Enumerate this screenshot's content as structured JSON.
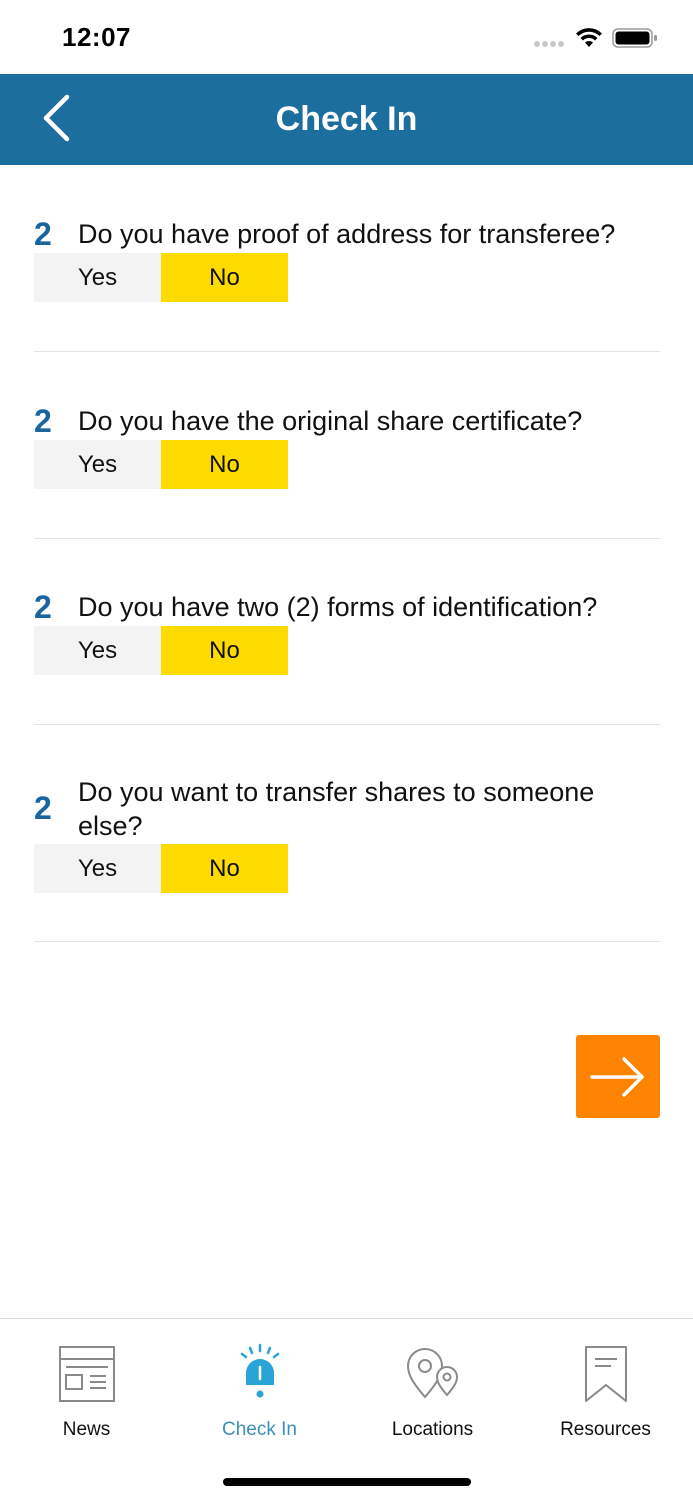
{
  "status_bar": {
    "time": "12:07"
  },
  "header": {
    "title": "Check In"
  },
  "questions": [
    {
      "number": "2",
      "text": "Do you have proof of address for transferee?",
      "yes_label": "Yes",
      "no_label": "No",
      "selected": "No"
    },
    {
      "number": "2",
      "text": "Do you have the original share certificate?",
      "yes_label": "Yes",
      "no_label": "No",
      "selected": "No"
    },
    {
      "number": "2",
      "text": "Do you have two (2) forms of identification?",
      "yes_label": "Yes",
      "no_label": "No",
      "selected": "No"
    },
    {
      "number": "2",
      "text": "Do you want to transfer shares to someone else?",
      "yes_label": "Yes",
      "no_label": "No",
      "selected": "No"
    }
  ],
  "tab_bar": {
    "items": [
      {
        "label": "News",
        "icon": "news-icon",
        "active": false
      },
      {
        "label": "Check In",
        "icon": "alert-bell-icon",
        "active": true
      },
      {
        "label": "Locations",
        "icon": "location-pin-icon",
        "active": false
      },
      {
        "label": "Resources",
        "icon": "bookmark-icon",
        "active": false
      }
    ]
  },
  "colors": {
    "header": "#1b6e9e",
    "selected_option": "#fddb00",
    "unselected_option": "#f3f3f3",
    "question_number": "#1a65a0",
    "next_button": "#fd8300",
    "active_tab": "#3b90b9"
  }
}
